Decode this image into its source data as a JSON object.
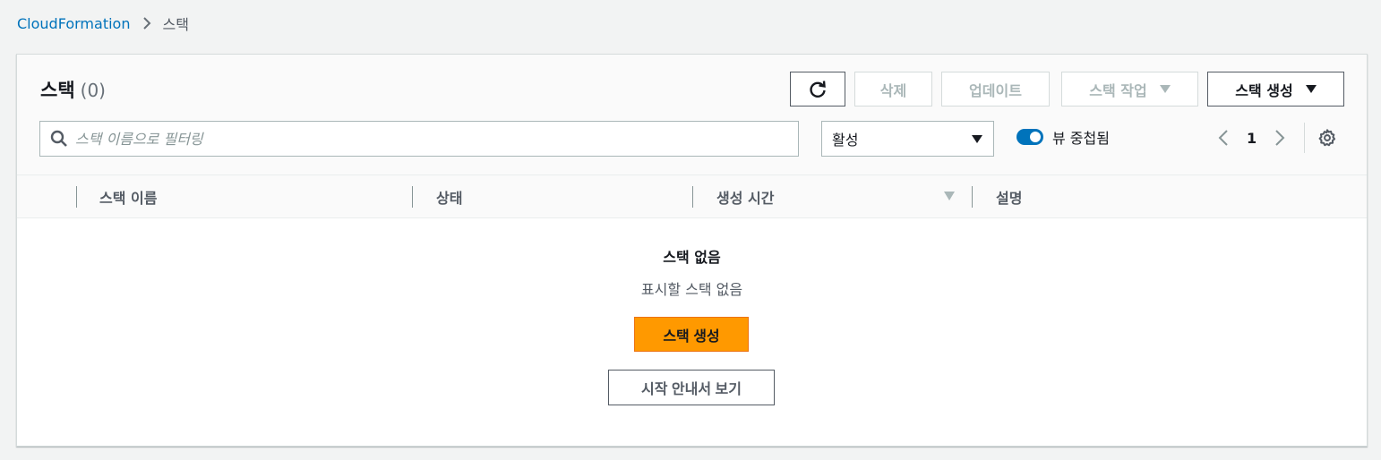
{
  "breadcrumb": {
    "root": "CloudFormation",
    "current": "스택"
  },
  "header": {
    "title": "스택",
    "count": "(0)"
  },
  "toolbar": {
    "delete_label": "삭제",
    "update_label": "업데이트",
    "actions_label": "스택 작업",
    "create_label": "스택 생성"
  },
  "filter": {
    "search_placeholder": "스택 이름으로 필터링",
    "status_value": "활성",
    "toggle_label": "뷰 중첩됨",
    "toggle_on": true
  },
  "pagination": {
    "page": "1"
  },
  "table": {
    "columns": [
      "스택 이름",
      "상태",
      "생성 시간",
      "설명"
    ]
  },
  "empty_state": {
    "title": "스택 없음",
    "subtitle": "표시할 스택 없음",
    "create_button": "스택 생성",
    "guide_button": "시작 안내서 보기"
  },
  "colors": {
    "link": "#0073bb",
    "primary": "#ff9900",
    "toggle": "#0073bb"
  }
}
